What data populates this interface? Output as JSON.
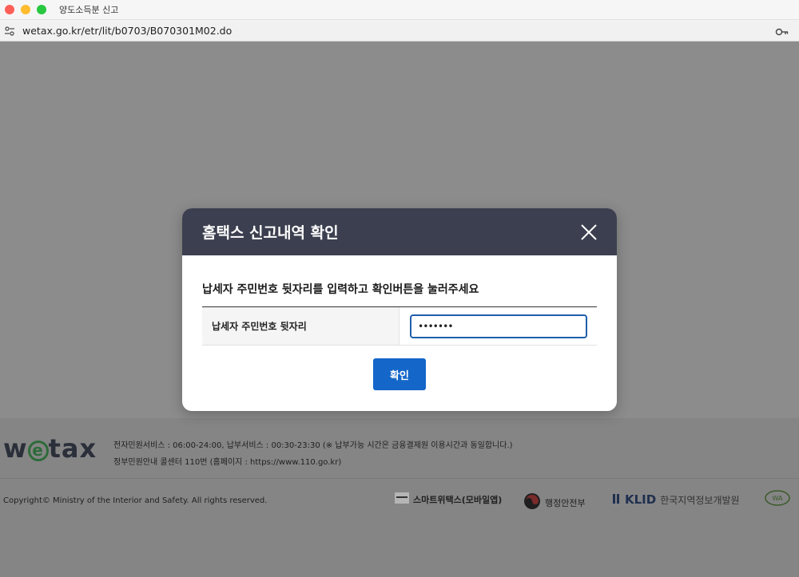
{
  "window": {
    "title": "양도소득분 신고",
    "url": "wetax.go.kr/etr/lit/b0703/B070301M02.do"
  },
  "modal": {
    "title": "홈택스 신고내역 확인",
    "instruction": "납세자 주민번호 뒷자리를 입력하고 확인버튼을 눌러주세요",
    "field_label": "납세자 주민번호 뒷자리",
    "field_value": "•••••••",
    "confirm_label": "확인"
  },
  "footer": {
    "logo": "wetax",
    "service_hours": "전자민원서비스 : 06:00-24:00, 납부서비스 : 00:30-23:30 (※ 납부가능 시간은 금융결제원 이용시간과 동일합니다.)",
    "call_center": "정부민원안내 콜센터 110번 (홈페이지 : https://www.110.go.kr)",
    "copyright": "Copyright© Ministry of the Interior and Safety. All rights reserved.",
    "partners": {
      "smart_wetax": "스마트위택스(모바일앱)",
      "ministry": "행정안전부",
      "klid_abbr": "KLID",
      "klid_name": "한국지역정보개발원"
    }
  },
  "colors": {
    "modal_header": "#3c3f4f",
    "confirm_button": "#1466c9",
    "input_border": "#1f5faa"
  }
}
